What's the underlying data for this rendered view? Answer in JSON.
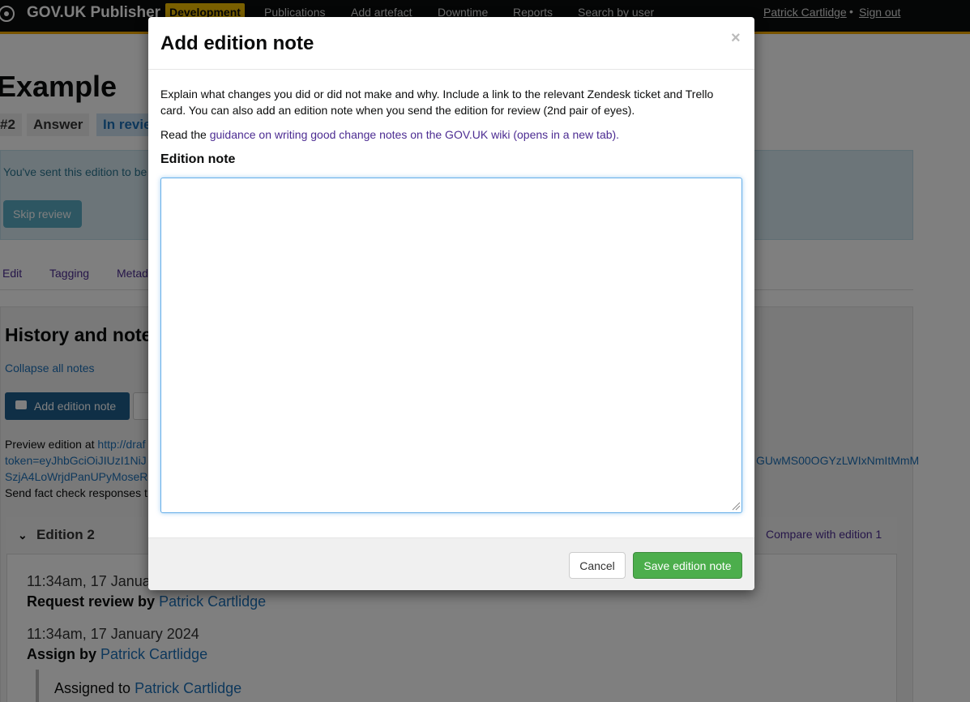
{
  "header": {
    "brand": "GOV.UK Publisher",
    "environment": "Development",
    "nav": [
      "Publications",
      "Add artefact",
      "Downtime",
      "Reports",
      "Search by user"
    ],
    "user_name": "Patrick Cartlidge",
    "separator": "•",
    "sign_out": "Sign out"
  },
  "background": {
    "title": "Example",
    "tags": [
      "#2",
      "Answer",
      "In revie"
    ],
    "alert_text": "You've sent this edition to be",
    "skip_review": "Skip review",
    "tabs": [
      "Edit",
      "Tagging",
      "Metad"
    ],
    "history_title": "History and note",
    "collapse_all": "Collapse all notes",
    "add_edition_note": "Add edition note",
    "preview_label": "Preview edition at ",
    "preview_url": "http://draf",
    "token_line": "token=eyJhbGciOiJIUzI1NiJ",
    "token_right": "GUwMS00OGYzLWIxNmItMmM",
    "token_line2": "SzjA4LoWrjdPanUPyMoseR",
    "fact_check": "Send fact check responses t",
    "edition_title": "Edition 2",
    "compare": "Compare with edition 1",
    "history": [
      {
        "time": "11:34am, 17 Janua",
        "action": "Request review by ",
        "person": "Patrick Cartlidge"
      },
      {
        "time": "11:34am, 17 January 2024",
        "action": "Assign by ",
        "person": "Patrick Cartlidge"
      }
    ],
    "assigned_label": "Assigned to ",
    "assigned_person": "Patrick Cartlidge"
  },
  "modal": {
    "title": "Add edition note",
    "close": "×",
    "intro": "Explain what changes you did or did not make and why. Include a link to the relevant Zendesk ticket and Trello card. You can also add an edition note when you send the edition for review (2nd pair of eyes).",
    "guidance_prefix": "Read the ",
    "guidance_link": "guidance on writing good change notes on the GOV.UK wiki (opens in a new tab).",
    "field_label": "Edition note",
    "note_value": "",
    "cancel": "Cancel",
    "save": "Save edition note"
  }
}
